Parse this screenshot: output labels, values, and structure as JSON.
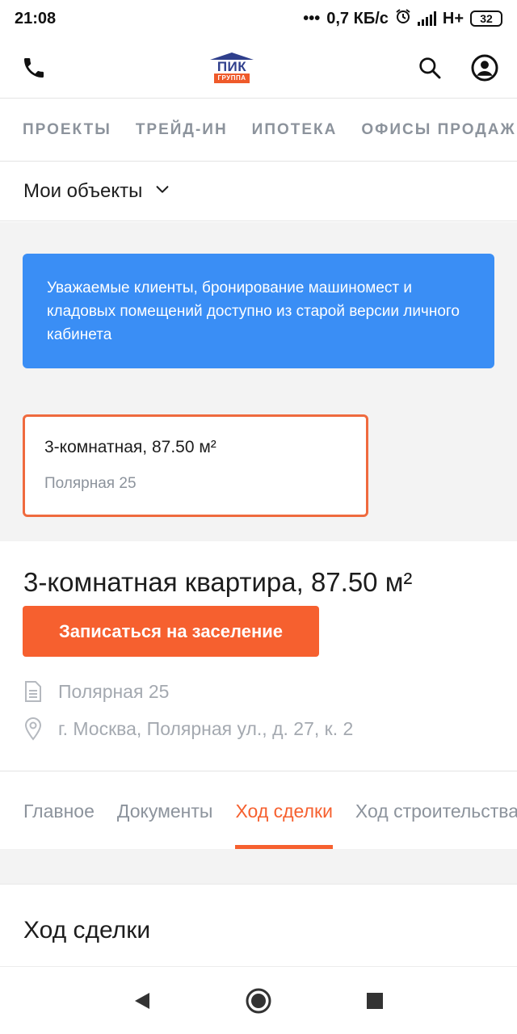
{
  "status_bar": {
    "time": "21:08",
    "network_speed": "0,7 КБ/с",
    "network_type": "H+",
    "battery": "32"
  },
  "header": {
    "logo_text": "ПИК",
    "logo_sub": "ГРУППА",
    "icons": [
      "phone-icon",
      "search-icon",
      "profile-icon"
    ]
  },
  "nav": {
    "tabs": [
      "ПРОЕКТЫ",
      "ТРЕЙД-ИН",
      "ИПОТЕКА",
      "ОФИСЫ ПРОДАЖ"
    ]
  },
  "my_objects": {
    "label": "Мои объекты"
  },
  "notice": {
    "text": "Уважаемые клиенты, бронирование машиномест и кладовых помещений доступно из старой версии личного кабинета",
    "color": "#3a8ef5"
  },
  "object_card": {
    "title": "3-комнатная, 87.50 м²",
    "project": "Полярная 25",
    "border_color": "#ef6a3e"
  },
  "details": {
    "title": "3-комнатная квартира, 87.50 м²",
    "button_label": "Записаться на заселение",
    "project": "Полярная 25",
    "address": "г. Москва, Полярная ул., д. 27, к. 2",
    "accent_color": "#f6602f"
  },
  "detail_tabs": {
    "tabs": [
      "Главное",
      "Документы",
      "Ход сделки",
      "Ход строительства"
    ],
    "active": "Ход сделки"
  },
  "section": {
    "title": "Ход сделки"
  }
}
